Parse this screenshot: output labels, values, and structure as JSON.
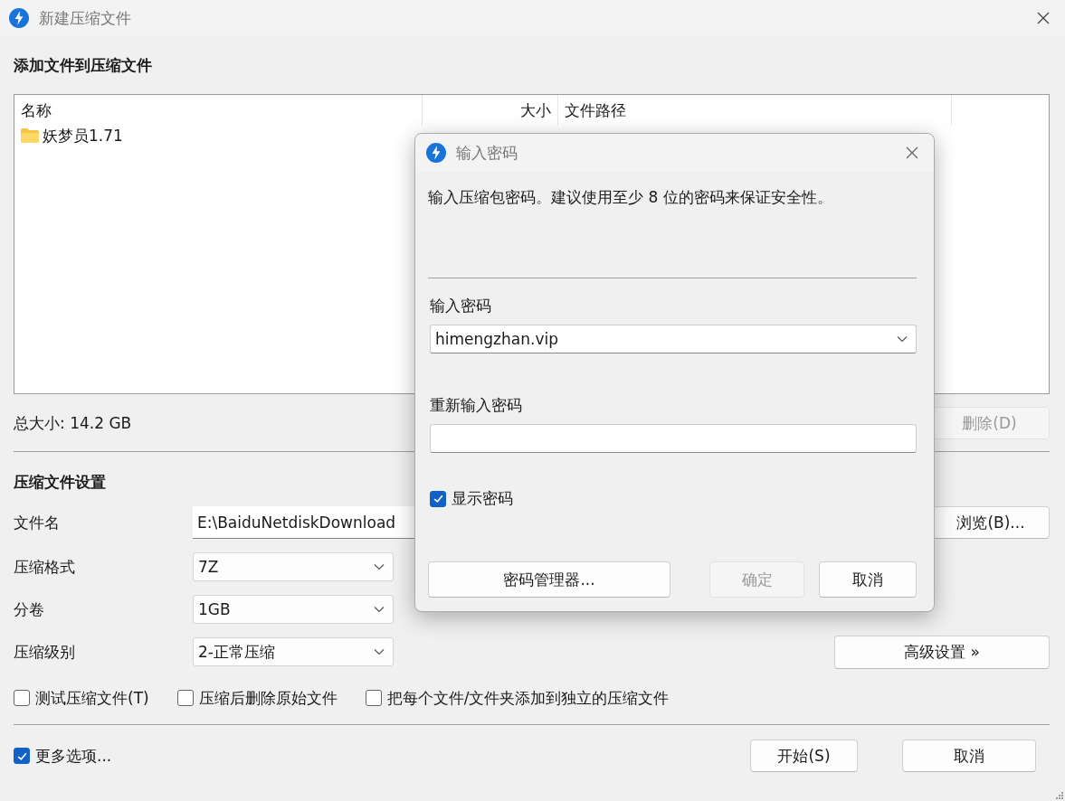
{
  "window": {
    "title": "新建压缩文件"
  },
  "files": {
    "heading": "添加文件到压缩文件",
    "columns": [
      "名称",
      "大小",
      "文件路径"
    ],
    "rows": [
      {
        "name": "妖梦员1.71"
      }
    ]
  },
  "total_size": "总大小: 14.2 GB",
  "delete_button": {
    "label": "删除(D)",
    "disabled": true
  },
  "settings": {
    "heading": "压缩文件设置",
    "fields": [
      {
        "kind": "text",
        "label": "文件名",
        "value": "E:\\BaiduNetdiskDownload",
        "button": "浏览(B)..."
      },
      {
        "kind": "select",
        "label": "压缩格式",
        "value": "7Z"
      },
      {
        "kind": "select",
        "label": "分卷",
        "value": "1GB"
      },
      {
        "kind": "select",
        "label": "压缩级别",
        "value": "2-正常压缩",
        "button": "高级设置 »"
      }
    ]
  },
  "options": [
    {
      "label": "测试压缩文件(T)",
      "checked": false
    },
    {
      "label": "压缩后删除原始文件",
      "checked": false
    },
    {
      "label": "把每个文件/文件夹添加到独立的压缩文件",
      "checked": false
    }
  ],
  "more_options": {
    "label": "更多选项...",
    "checked": true
  },
  "buttons": [
    "开始(S)",
    "取消"
  ],
  "password_dialog": {
    "title": "输入密码",
    "message": "输入压缩包密码。建议使用至少 8 位的密码来保证安全性。",
    "password_label": "输入密码",
    "password_value": "himengzhan.vip",
    "confirm_label": "重新输入密码",
    "show_password": {
      "label": "显示密码",
      "checked": true
    },
    "buttons": [
      {
        "label": "密码管理器...",
        "disabled": false
      },
      {
        "label": "确定",
        "disabled": true
      },
      {
        "label": "取消",
        "disabled": false
      }
    ]
  }
}
